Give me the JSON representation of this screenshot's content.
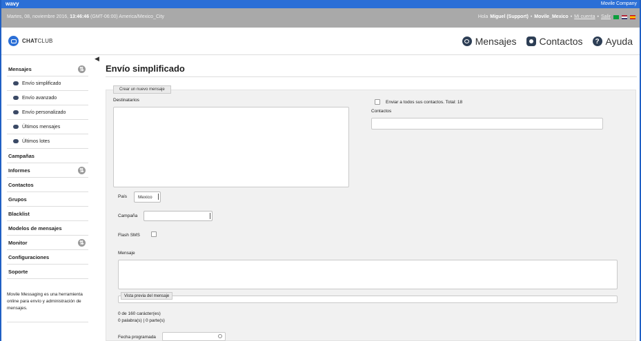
{
  "brand": {
    "logo": "wavy",
    "company": "Movile Company"
  },
  "info": {
    "date_prefix": "Martes, 08, noviembre 2016,",
    "time": "13:46:46",
    "tz": "(GMT-06:00) America/Mexico_City",
    "greeting": "Hola",
    "user": "Miguel (Support)",
    "account": "Movile_Mexico",
    "my_account": "Mi cuenta",
    "logout": "Salir",
    "separator": "•"
  },
  "header": {
    "app_name_bold": "CHAT",
    "app_name_light": "CLUB",
    "nav": [
      {
        "label": "Mensajes",
        "icon": "chat-bubble-icon"
      },
      {
        "label": "Contactos",
        "icon": "user-icon"
      },
      {
        "label": "Ayuda",
        "icon": "help-icon",
        "glyph": "?"
      }
    ]
  },
  "sidebar": {
    "mensajes": "Mensajes",
    "sub": [
      "Envío simplificado",
      "Envío avanzado",
      "Envío personalizado",
      "Últimos mensajes",
      "Últimos lotes"
    ],
    "items": [
      "Campañas",
      "Informes",
      "Contactos",
      "Grupos",
      "Blacklist",
      "Modelos de mensajes",
      "Monitor",
      "Configuraciones",
      "Soporte"
    ],
    "description": "Movile Messaging es una herramienta online para envío y administración de mensajes."
  },
  "main": {
    "title": "Envío simplificado",
    "tab": "Crear un nuevo mensaje",
    "destinatarios": "Destinatarios",
    "send_all": "Enviar a todos sus contactos. Total: 18",
    "contactos": "Contactos",
    "pais_label": "País",
    "pais_value": "Mexico",
    "campana_label": "Campaña",
    "flash_label": "Flash SMS",
    "mensaje_label": "Mensaje",
    "preview": "Vista previa del mensaje",
    "chars": "0 de 160 carácter(es)",
    "words": "0 palabra(s) | 0 parte(s)",
    "fecha_label": "Fecha programada"
  }
}
